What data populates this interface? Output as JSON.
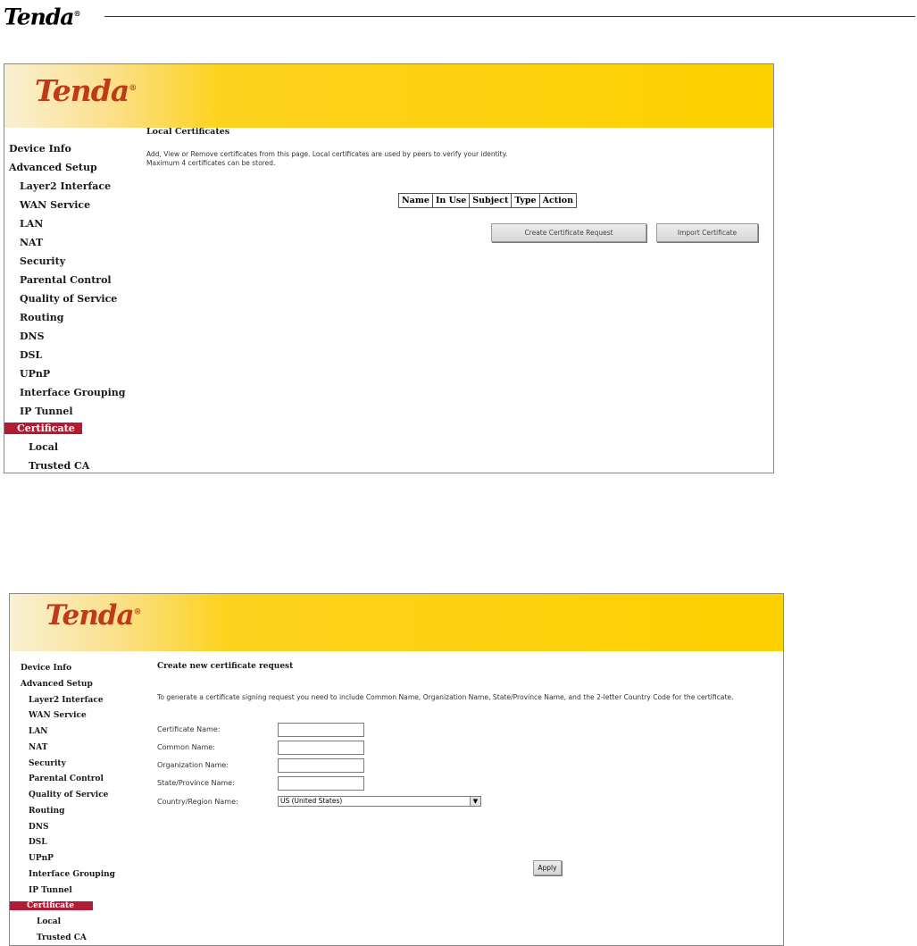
{
  "doc": {
    "logo": "Tenda",
    "logo_mark": "®"
  },
  "screen1": {
    "brand": "Tenda",
    "brand_mark": "®",
    "sidebar": [
      "Device Info",
      "Advanced Setup",
      "Layer2 Interface",
      "WAN Service",
      "LAN",
      "NAT",
      "Security",
      "Parental Control",
      "Quality of Service",
      "Routing",
      "DNS",
      "DSL",
      "UPnP",
      "Interface Grouping",
      "IP Tunnel",
      "Certificate",
      "Local",
      "Trusted CA"
    ],
    "title": "Local Certificates",
    "desc1": "Add, View or Remove certificates from this page. Local certificates are used by peers to verify your identity.",
    "desc2": "Maximum 4 certificates can be stored.",
    "table_headers": [
      "Name",
      "In Use",
      "Subject",
      "Type",
      "Action"
    ],
    "btn_create": "Create Certificate Request",
    "btn_import": "Import Certificate"
  },
  "screen2": {
    "brand": "Tenda",
    "brand_mark": "®",
    "sidebar": [
      "Device Info",
      "Advanced Setup",
      "Layer2 Interface",
      "WAN Service",
      "LAN",
      "NAT",
      "Security",
      "Parental Control",
      "Quality of Service",
      "Routing",
      "DNS",
      "DSL",
      "UPnP",
      "Interface Grouping",
      "IP Tunnel",
      "Certificate",
      "Local",
      "Trusted CA"
    ],
    "title": "Create new certificate request",
    "desc": "To generate a certificate signing request you need to include Common Name, Organization Name, State/Province Name, and the 2-letter Country Code for the certificate.",
    "fields": {
      "cert_name": {
        "label": "Certificate Name:",
        "value": ""
      },
      "common_name": {
        "label": "Common Name:",
        "value": ""
      },
      "org_name": {
        "label": "Organization Name:",
        "value": ""
      },
      "state_name": {
        "label": "State/Province Name:",
        "value": ""
      },
      "country": {
        "label": "Country/Region Name:",
        "value": "US (United States)"
      }
    },
    "btn_apply": "Apply"
  },
  "colors": {
    "banner": "#fdd000",
    "brand": "#c03a17",
    "active_nav": "#b31b34"
  },
  "icons": {
    "dropdown": "chevron-down-icon"
  }
}
